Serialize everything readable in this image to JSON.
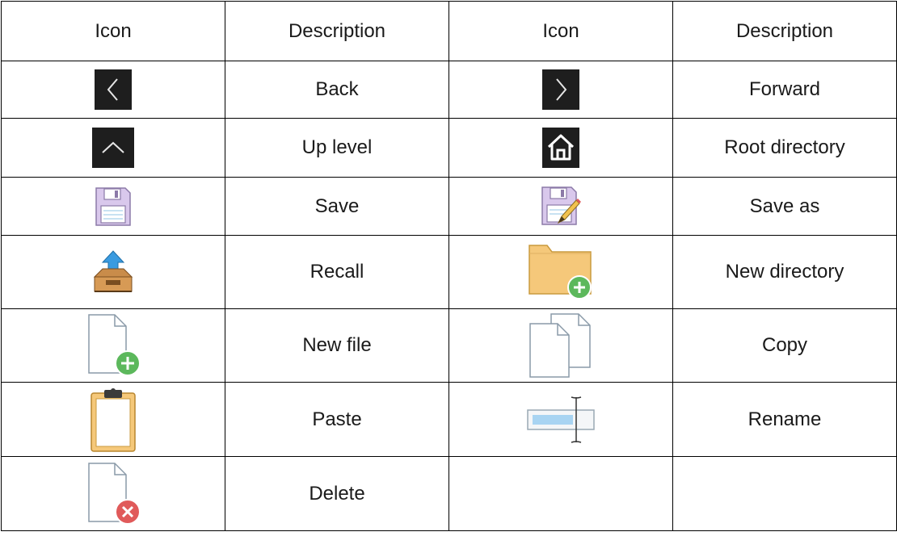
{
  "headers": [
    "Icon",
    "Description",
    "Icon",
    "Description"
  ],
  "rows": [
    {
      "left": {
        "icon": "back-icon",
        "label": "Back"
      },
      "right": {
        "icon": "forward-icon",
        "label": "Forward"
      }
    },
    {
      "left": {
        "icon": "up-level-icon",
        "label": "Up level"
      },
      "right": {
        "icon": "root-directory-icon",
        "label": "Root directory"
      }
    },
    {
      "left": {
        "icon": "save-icon",
        "label": "Save"
      },
      "right": {
        "icon": "save-as-icon",
        "label": "Save as"
      }
    },
    {
      "left": {
        "icon": "recall-icon",
        "label": "Recall"
      },
      "right": {
        "icon": "new-directory-icon",
        "label": "New directory"
      }
    },
    {
      "left": {
        "icon": "new-file-icon",
        "label": "New file"
      },
      "right": {
        "icon": "copy-icon",
        "label": "Copy"
      }
    },
    {
      "left": {
        "icon": "paste-icon",
        "label": "Paste"
      },
      "right": {
        "icon": "rename-icon",
        "label": "Rename"
      }
    },
    {
      "left": {
        "icon": "delete-icon",
        "label": "Delete"
      },
      "right": {
        "icon": "",
        "label": ""
      }
    }
  ],
  "colors": {
    "dark_button": "#1e1e1e",
    "folder": "#f5c87a",
    "green_badge": "#5cb85c",
    "red_badge": "#e05a5a",
    "lavender": "#d9c8ec"
  }
}
